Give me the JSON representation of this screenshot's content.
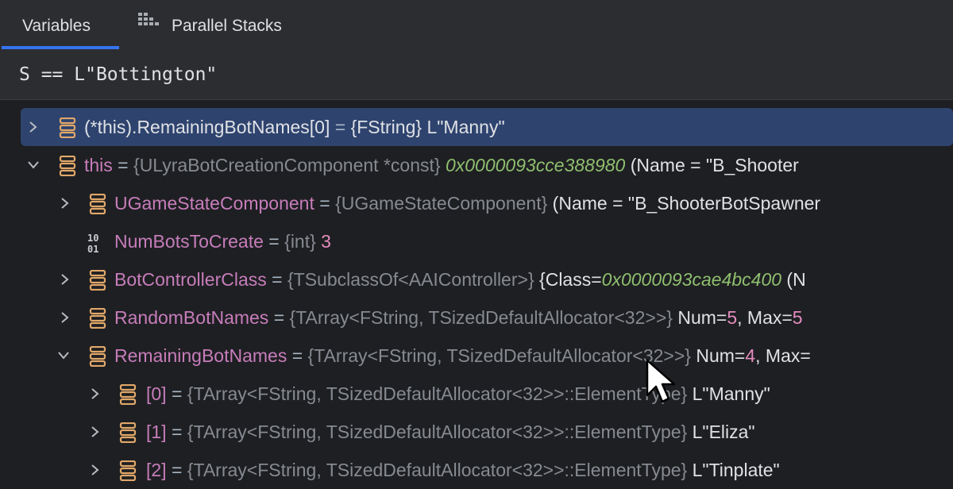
{
  "tabs": [
    {
      "label": "Variables"
    },
    {
      "label": "Parallel Stacks"
    }
  ],
  "eval": {
    "lhs": "S == L",
    "string": "\"Bottington\""
  },
  "rows": [
    {
      "name": "(*this).RemainingBotNames[0]",
      "eq": " = ",
      "type": "{FString}",
      "value": " L\"Manny\""
    },
    {
      "name": "this",
      "eq": " = ",
      "type": "{ULyraBotCreationComponent *const}",
      "addr": " 0x0000093cce388980",
      "rest": " (Name = \"B_Shooter"
    },
    {
      "name": "UGameStateComponent",
      "eq": " = ",
      "type": "{UGameStateComponent}",
      "rest": " (Name = \"B_ShooterBotSpawner"
    },
    {
      "name": "NumBotsToCreate",
      "eq": " = ",
      "type": "{int}",
      "num": " 3"
    },
    {
      "name": "BotControllerClass",
      "eq": " = ",
      "type": "{TSubclassOf<AAIController>}",
      "rest": " {Class=",
      "addr": "0x0000093cae4bc400",
      "rest2": " (N"
    },
    {
      "name": "RandomBotNames",
      "eq": " = ",
      "type": "{TArray<FString, TSizedDefaultAllocator<32>>}",
      "rest": " Num=",
      "num": "5",
      "rest2": ", Max=",
      "num2": "5"
    },
    {
      "name": "RemainingBotNames",
      "eq": " = ",
      "type": "{TArray<FString, TSizedDefaultAllocator<32>>}",
      "rest": " Num=",
      "num": "4",
      "rest2": ", Max="
    },
    {
      "name": "[0]",
      "eq": " = ",
      "type": "{TArray<FString, TSizedDefaultAllocator<32>>::ElementType}",
      "value": " L\"Manny\""
    },
    {
      "name": "[1]",
      "eq": " = ",
      "type": "{TArray<FString, TSizedDefaultAllocator<32>>::ElementType}",
      "value": " L\"Eliza\""
    },
    {
      "name": "[2]",
      "eq": " = ",
      "type": "{TArray<FString, TSizedDefaultAllocator<32>>::ElementType}",
      "value": " L\"Tinplate\""
    }
  ],
  "icons": {
    "field": "stacked-field-icon",
    "int": "binary-10-01-icon",
    "parallel": "parallel-stacks-icon"
  },
  "colors": {
    "accent": "#3574f0",
    "selection": "#2e436e",
    "field_icon": "#e0a769",
    "name": "#c77dbb",
    "address": "#8fbf6f",
    "number": "#e48bbd"
  }
}
